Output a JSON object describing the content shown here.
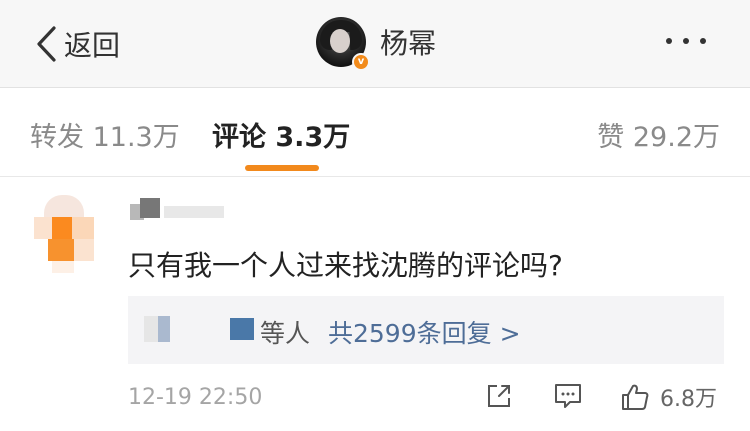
{
  "header": {
    "back_label": "返回",
    "profile_name": "杨幂",
    "verified_badge": "v"
  },
  "tabs": {
    "repost": "转发 11.3万",
    "comment": "评论 3.3万",
    "like": "赞 29.2万"
  },
  "comment": {
    "text": "只有我一个人过来找沈腾的评论吗?",
    "reply_others": "等人",
    "reply_total": "共2599条回复 >",
    "timestamp": "12-19 22:50",
    "like_count": "6.8万"
  },
  "icons": [
    "chevron-left-icon",
    "more-dots-icon",
    "share-icon",
    "comment-icon",
    "thumbs-up-icon"
  ],
  "colors": {
    "accent": "#f2891c",
    "reply_link": "#4e6d97"
  }
}
